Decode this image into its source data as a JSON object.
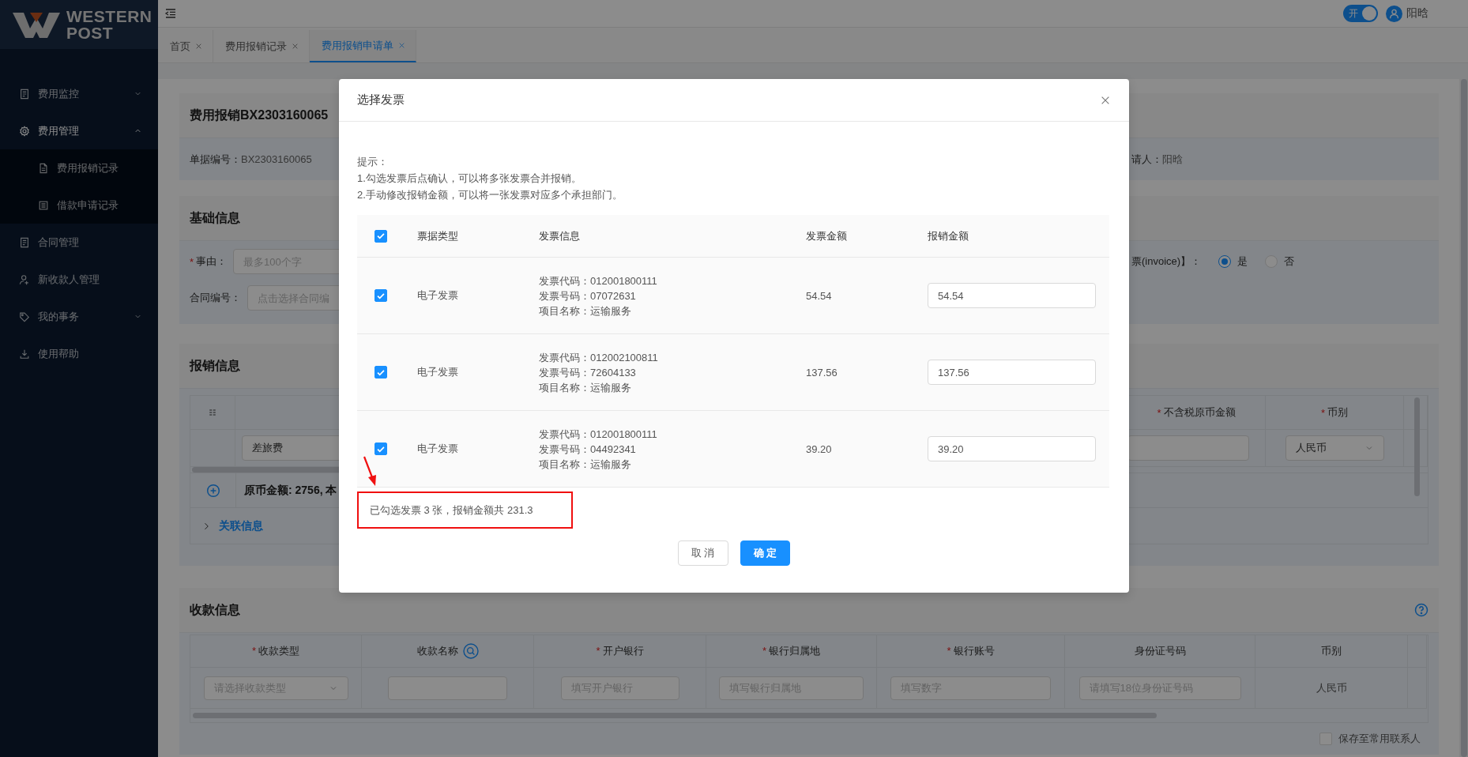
{
  "logo": {
    "line1": "WESTERN",
    "line2": "POST"
  },
  "sidebar": {
    "items": [
      {
        "label": "费用监控",
        "kind": "group",
        "expanded": false
      },
      {
        "label": "费用管理",
        "kind": "group",
        "expanded": true,
        "children": [
          {
            "label": "费用报销记录"
          },
          {
            "label": "借款申请记录"
          }
        ]
      },
      {
        "label": "合同管理",
        "kind": "link"
      },
      {
        "label": "新收款人管理",
        "kind": "link"
      },
      {
        "label": "我的事务",
        "kind": "group",
        "expanded": false
      },
      {
        "label": "使用帮助",
        "kind": "link"
      }
    ]
  },
  "topbar": {
    "switch": {
      "label": "开",
      "on": true
    },
    "user": {
      "name": "阳晗"
    }
  },
  "tabs": [
    {
      "label": "首页",
      "selected": false
    },
    {
      "label": "费用报销记录",
      "selected": false
    },
    {
      "label": "费用报销申请单",
      "selected": true
    }
  ],
  "summary_card": {
    "title": "费用报销BX2303160065",
    "number": {
      "label": "单据编号：",
      "value": "BX2303160065"
    },
    "applicant": {
      "label": "请人：",
      "value": "阳晗"
    }
  },
  "basic_info": {
    "title": "基础信息",
    "reason": {
      "mark": "*",
      "label": "事由：",
      "placeholder": "最多100个字"
    },
    "contract": {
      "label": "合同编号：",
      "placeholder": "点击选择合同编"
    },
    "invoice_option": {
      "label": "票(invoice)】：",
      "options": [
        {
          "label": "是",
          "selected": true
        },
        {
          "label": "否",
          "selected": false
        }
      ]
    }
  },
  "expense_info": {
    "title": "报销信息",
    "columns": [
      {
        "mark": "*",
        "label": "不含税原币金额"
      },
      {
        "mark": "*",
        "label": "币别"
      }
    ],
    "row": {
      "category": "差旅费",
      "currency": "人民币"
    },
    "total": "原币金额: 2756, 本",
    "related": "关联信息"
  },
  "payee_info": {
    "title": "收款信息",
    "columns": [
      {
        "mark": "*",
        "label": "收款类型"
      },
      {
        "label": "收款名称",
        "search": true
      },
      {
        "mark": "*",
        "label": "开户银行"
      },
      {
        "mark": "*",
        "label": "银行归属地"
      },
      {
        "mark": "*",
        "label": "银行账号"
      },
      {
        "label": "身份证号码"
      },
      {
        "label": "币别"
      }
    ],
    "row": [
      {
        "kind": "select",
        "placeholder": "请选择收款类型"
      },
      {
        "kind": "input"
      },
      {
        "kind": "input",
        "placeholder": "填写开户银行"
      },
      {
        "kind": "input",
        "placeholder": "填写银行归属地"
      },
      {
        "kind": "input",
        "placeholder": "填写数字"
      },
      {
        "kind": "input",
        "placeholder": "请填写18位身份证号码"
      },
      {
        "kind": "text",
        "value": "人民币"
      }
    ],
    "save_contact": {
      "label": "保存至常用联系人",
      "checked": false
    }
  },
  "dialog": {
    "title": "选择发票",
    "hints": [
      "提示：",
      "1.勾选发票后点确认，可以将多张发票合并报销。",
      "2.手动修改报销金额，可以将一张发票对应多个承担部门。"
    ],
    "columns": [
      "票据类型",
      "发票信息",
      "发票金额",
      "报销金额"
    ],
    "all_checked": true,
    "rows": [
      {
        "checked": true,
        "type": "电子发票",
        "info": [
          "发票代码：012001800111",
          "发票号码：07072631",
          "项目名称：运输服务"
        ],
        "amount": "54.54",
        "reimburse": "54.54"
      },
      {
        "checked": true,
        "type": "电子发票",
        "info": [
          "发票代码：012002100811",
          "发票号码：72604133",
          "项目名称：运输服务"
        ],
        "amount": "137.56",
        "reimburse": "137.56"
      },
      {
        "checked": true,
        "type": "电子发票",
        "info": [
          "发票代码：012001800111",
          "发票号码：04492341",
          "项目名称：运输服务"
        ],
        "amount": "39.20",
        "reimburse": "39.20"
      }
    ],
    "summary": "已勾选发票 3 张，报销金额共 231.3",
    "buttons": [
      {
        "label": "取 消",
        "kind": "default"
      },
      {
        "label": "确 定",
        "kind": "primary"
      }
    ]
  }
}
